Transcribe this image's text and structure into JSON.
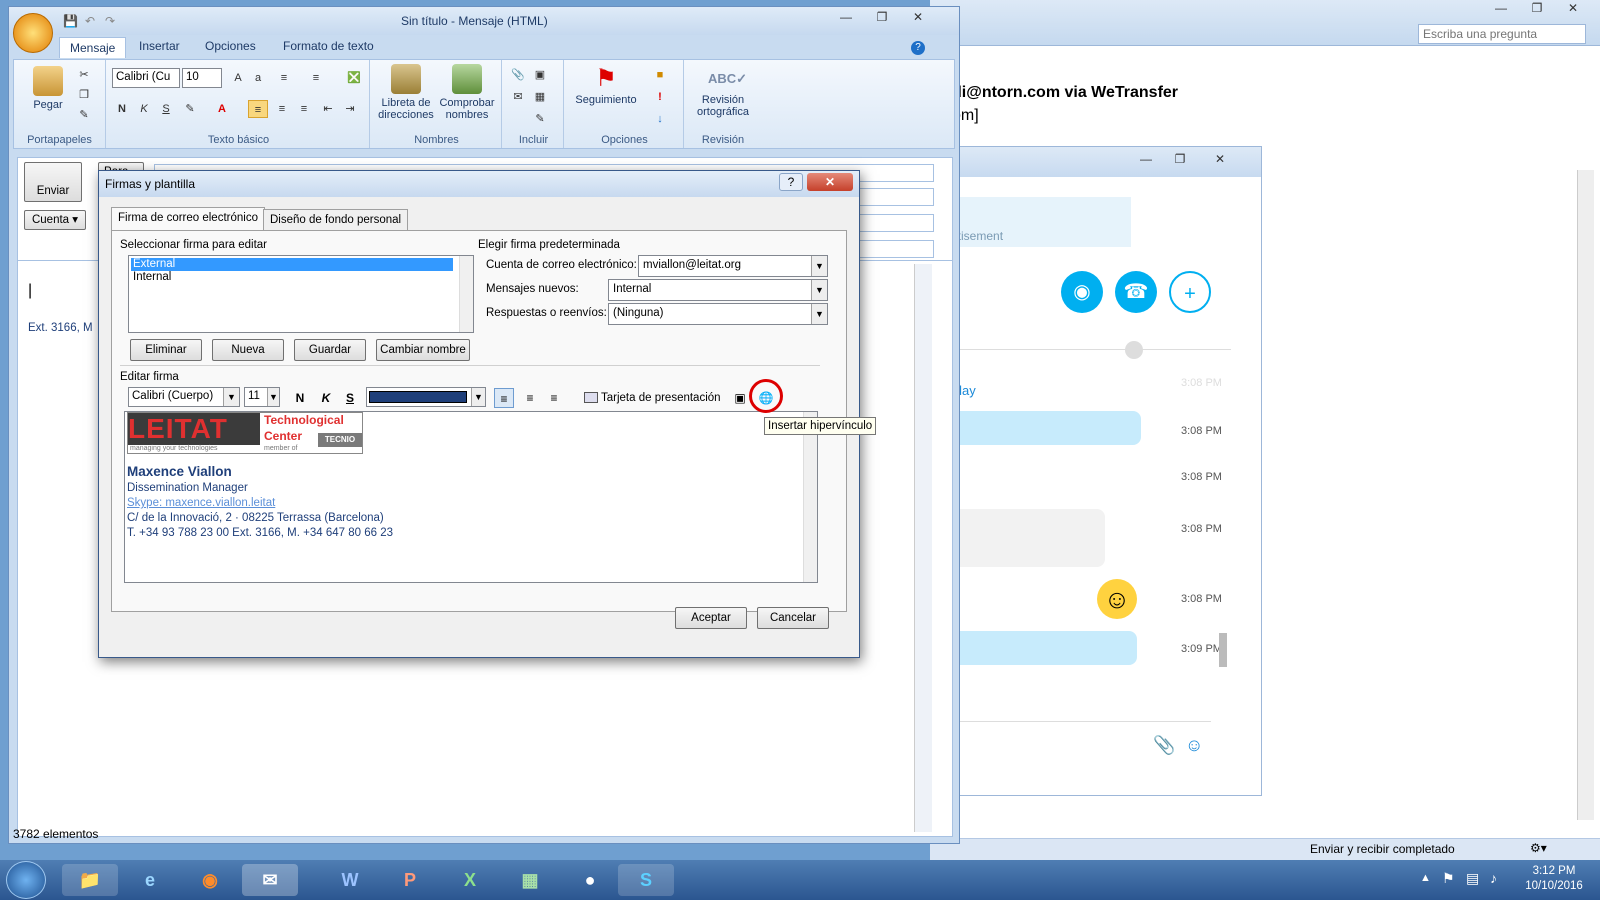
{
  "bg_window": {
    "search_placeholder": "Escriba una pregunta",
    "sender_line": "di@ntorn.com via WeTransfer",
    "sender_line2": "om]",
    "status_right": "Enviar y recibir completado",
    "status_left": "3782 elementos"
  },
  "skype": {
    "ad_text": "vertisement",
    "today": "Today",
    "timestamps": [
      "3:08 PM",
      "3:08 PM",
      "3:08 PM",
      "3:08 PM",
      "3:09 PM"
    ],
    "faded_time": "3:08 PM"
  },
  "message_window": {
    "title": "Sin título - Mensaje (HTML)",
    "tabs": [
      "Mensaje",
      "Insertar",
      "Opciones",
      "Formato de texto"
    ],
    "groups": {
      "portapapeles": "Portapapeles",
      "texto_basico": "Texto básico",
      "nombres": "Nombres",
      "incluir": "Incluir",
      "opciones": "Opciones",
      "revision": "Revisión"
    },
    "buttons": {
      "pegar": "Pegar",
      "libreta_1": "Libreta de",
      "libreta_2": "direcciones",
      "comprobar_1": "Comprobar",
      "comprobar_2": "nombres",
      "seguimiento": "Seguimiento",
      "revision_1": "Revisión",
      "revision_2": "ortográfica",
      "enviar": "Enviar",
      "cuenta": "Cuenta",
      "para": "Para..."
    },
    "font_name": "Calibri (Cu",
    "font_size": "10",
    "body_fragment": "Ext. 3166, M"
  },
  "dialog": {
    "title": "Firmas y plantilla",
    "tabs": [
      "Firma de correo electrónico",
      "Diseño de fondo personal"
    ],
    "select_label": "Seleccionar firma para editar",
    "signatures": [
      "External",
      "Internal"
    ],
    "default_label": "Elegir firma predeterminada",
    "account_label": "Cuenta de correo electrónico:",
    "account_value": "mviallon@leitat.org",
    "new_label": "Mensajes nuevos:",
    "new_value": "Internal",
    "reply_label": "Respuestas o reenvíos:",
    "reply_value": "(Ninguna)",
    "buttons": {
      "delete": "Eliminar",
      "new": "Nueva",
      "save": "Guardar",
      "rename": "Cambiar nombre",
      "ok": "Aceptar",
      "cancel": "Cancelar"
    },
    "edit_label": "Editar firma",
    "font_name": "Calibri (Cuerpo)",
    "font_size": "11",
    "business_card": "Tarjeta de presentación",
    "tooltip": "Insertar hipervínculo",
    "logo": {
      "word": "LEITAT",
      "tag1": "Technological",
      "tag2": "Center",
      "tagline": "managing your technologies",
      "member": "member of",
      "tecnio": "TECNIO"
    },
    "signature": {
      "name": "Maxence Viallon",
      "role": "Dissemination Manager",
      "skype": "Skype: maxence.viallon.leitat",
      "address": "C/ de la Innovació, 2 · 08225 Terrassa (Barcelona)",
      "phone": "T. +34 93 788 23 00 Ext. 3166, M. +34 647 80 66 23"
    },
    "font_color": "#1f3f7a"
  },
  "taskbar": {
    "time": "3:12 PM",
    "date": "10/10/2016"
  }
}
